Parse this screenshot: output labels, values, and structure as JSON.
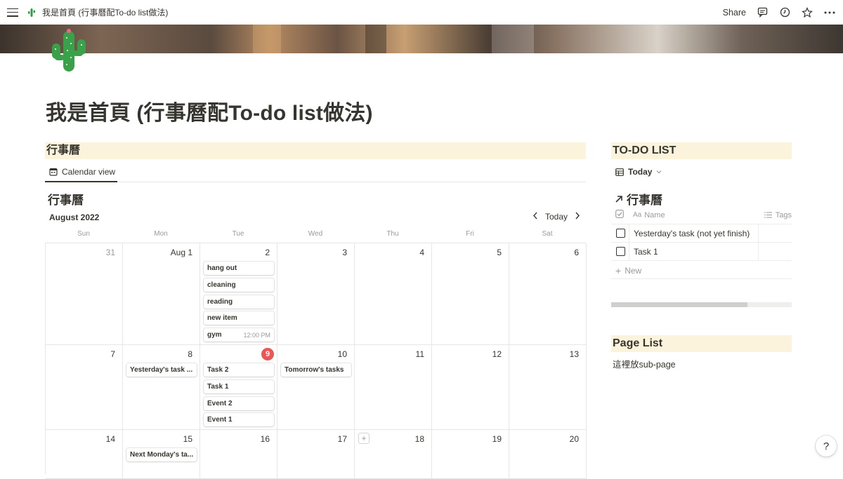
{
  "topbar": {
    "page_title": "我是首頁 (行事曆配To-do list做法)",
    "page_icon": "cactus-icon",
    "share_label": "Share"
  },
  "page": {
    "title": "我是首頁 (行事曆配To-do list做法)"
  },
  "calendar_section": {
    "header": "行事曆",
    "view_tab": "Calendar view",
    "db_title": "行事曆",
    "month": "August 2022",
    "today_label": "Today",
    "weekdays": [
      "Sun",
      "Mon",
      "Tue",
      "Wed",
      "Thu",
      "Fri",
      "Sat"
    ],
    "weeks": [
      {
        "days": [
          "31",
          "Aug 1",
          "2",
          "3",
          "4",
          "5",
          "6"
        ]
      },
      {
        "days": [
          "7",
          "8",
          "9",
          "10",
          "11",
          "12",
          "13"
        ]
      },
      {
        "days": [
          "14",
          "15",
          "16",
          "17",
          "18",
          "19",
          "20"
        ]
      }
    ],
    "events": {
      "aug2": [
        {
          "name": "hang out"
        },
        {
          "name": "cleaning"
        },
        {
          "name": "reading"
        },
        {
          "name": "new item"
        },
        {
          "name": "gym",
          "time": "12:00 PM"
        }
      ],
      "aug8": [
        {
          "name": "Yesterday's task ..."
        }
      ],
      "aug9": [
        {
          "name": "Task 2"
        },
        {
          "name": "Task 1"
        },
        {
          "name": "Event 2"
        },
        {
          "name": "Event 1"
        }
      ],
      "aug10": [
        {
          "name": "Tomorrow's tasks"
        }
      ],
      "aug15": [
        {
          "name": "Next Monday's ta..."
        }
      ]
    },
    "today_date": "9"
  },
  "todo_section": {
    "header": "TO-DO LIST",
    "view_tab": "Today",
    "db_title": "行事曆",
    "col_name": "Name",
    "col_tags": "Tags",
    "rows": [
      {
        "name": "Yesterday's task (not yet finish)"
      },
      {
        "name": "Task 1"
      }
    ],
    "new_label": "New"
  },
  "pagelist_section": {
    "header": "Page List",
    "text": "這裡放sub-page"
  },
  "help": "?"
}
